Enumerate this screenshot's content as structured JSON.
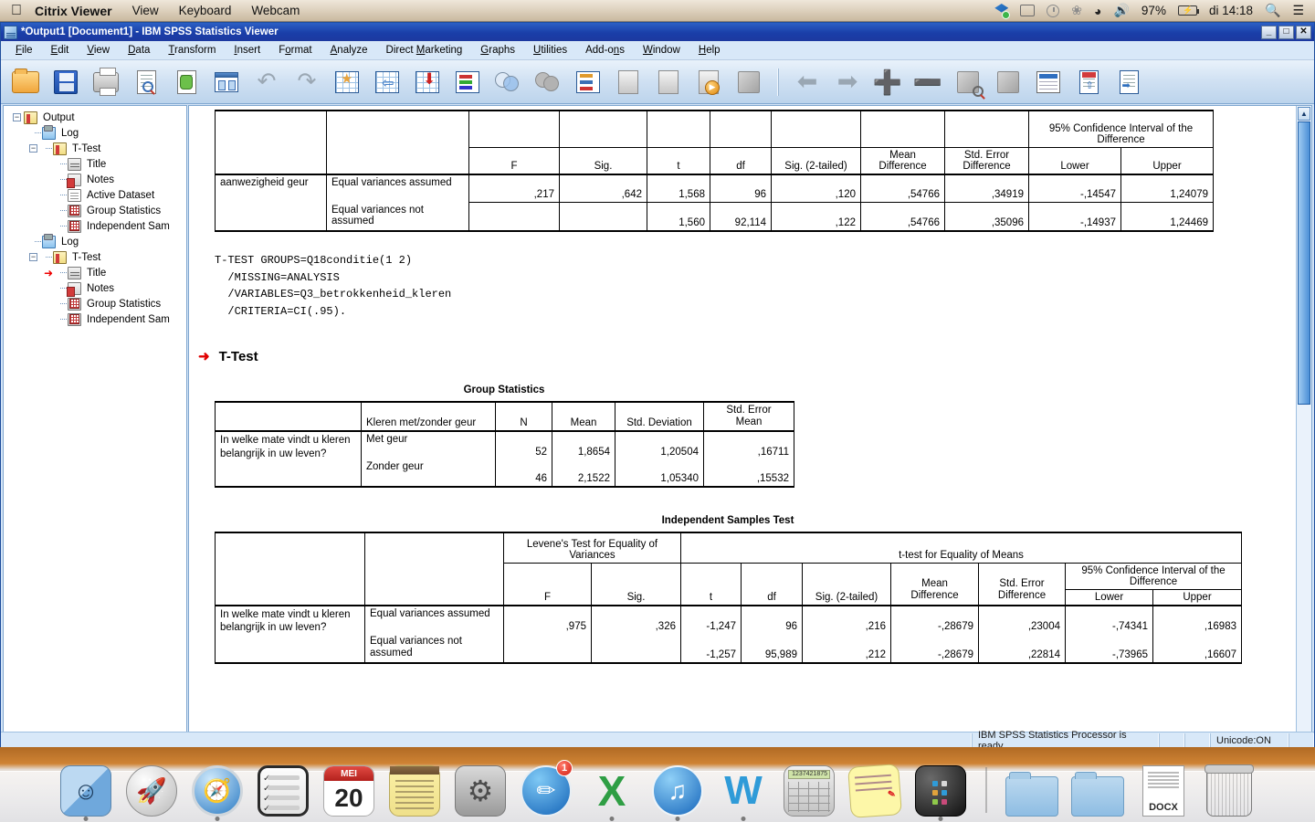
{
  "macbar": {
    "apple": "",
    "app_name": "Citrix Viewer",
    "menus": [
      "View",
      "Keyboard",
      "Webcam"
    ],
    "battery_pct": "97%",
    "clock": "di 14:18",
    "icons": [
      "dropbox-icon",
      "airplay-icon",
      "timemachine-icon",
      "bluetooth-icon",
      "wifi-icon",
      "volume-icon",
      "battery-icon",
      "spotlight-icon",
      "notification-center-icon"
    ]
  },
  "window": {
    "title": "*Output1 [Document1] - IBM SPSS Statistics Viewer",
    "minimize": "_",
    "maximize": "□",
    "close": "✕"
  },
  "menubar": {
    "items": [
      "File",
      "Edit",
      "View",
      "Data",
      "Transform",
      "Insert",
      "Format",
      "Analyze",
      "Direct Marketing",
      "Graphs",
      "Utilities",
      "Add-ons",
      "Window",
      "Help"
    ]
  },
  "toolbar": {
    "buttons": [
      "open-file-icon",
      "save-icon",
      "print-icon",
      "print-preview-icon",
      "recall-dialog-icon",
      "goto-data-icon",
      "undo-icon",
      "redo-icon",
      "goto-case-icon",
      "variables-icon",
      "insert-output-icon",
      "insert-syntax-icon",
      "venn-overlap-icon",
      "venn-solid-icon",
      "export-icon",
      "promote-icon",
      "demote-icon",
      "run-script-icon",
      "insert-image-icon",
      "back-icon",
      "forward-icon",
      "expand-icon",
      "collapse-icon",
      "preview-icon",
      "box-icon",
      "insert-title-icon",
      "insert-text-icon",
      "export-document-icon"
    ]
  },
  "tree": {
    "root": "Output",
    "items": [
      {
        "label": "Output",
        "icon": "output-icon",
        "level": 0,
        "toggle": "-"
      },
      {
        "label": "Log",
        "icon": "log-icon",
        "level": 1
      },
      {
        "label": "T-Test",
        "icon": "output-icon",
        "level": 1,
        "toggle": "-"
      },
      {
        "label": "Title",
        "icon": "title-icon",
        "level": 2
      },
      {
        "label": "Notes",
        "icon": "notes-icon",
        "level": 2
      },
      {
        "label": "Active Dataset",
        "icon": "dataset-icon",
        "level": 2
      },
      {
        "label": "Group Statistics",
        "icon": "table-icon",
        "level": 2
      },
      {
        "label": "Independent Sam",
        "icon": "table-icon",
        "level": 2
      },
      {
        "label": "Log",
        "icon": "log-icon",
        "level": 1
      },
      {
        "label": "T-Test",
        "icon": "output-icon",
        "level": 1,
        "toggle": "-"
      },
      {
        "label": "Title",
        "icon": "title-icon",
        "level": 2,
        "pointer": true
      },
      {
        "label": "Notes",
        "icon": "notes-icon",
        "level": 2
      },
      {
        "label": "Group Statistics",
        "icon": "table-icon",
        "level": 2
      },
      {
        "label": "Independent Sam",
        "icon": "table-icon",
        "level": 2
      }
    ]
  },
  "output": {
    "top_table": {
      "headers": {
        "f": "F",
        "sig": "Sig.",
        "t": "t",
        "df": "df",
        "sig2": "Sig. (2-tailed)",
        "mean_diff": "Mean Difference",
        "se_diff": "Std. Error Difference",
        "ci_title": "95% Confidence Interval of the Difference",
        "lower": "Lower",
        "upper": "Upper"
      },
      "row_label": "aanwezigheid geur",
      "rows": [
        {
          "assumption": "Equal variances assumed",
          "f": ",217",
          "sig": ",642",
          "t": "1,568",
          "df": "96",
          "sig2": ",120",
          "mean_diff": ",54766",
          "se_diff": ",34919",
          "lower": "-,14547",
          "upper": "1,24079"
        },
        {
          "assumption": "Equal variances not assumed",
          "f": "",
          "sig": "",
          "t": "1,560",
          "df": "92,114",
          "sig2": ",122",
          "mean_diff": ",54766",
          "se_diff": ",35096",
          "lower": "-,14937",
          "upper": "1,24469"
        }
      ]
    },
    "syntax": "T-TEST GROUPS=Q18conditie(1 2)\n  /MISSING=ANALYSIS\n  /VARIABLES=Q3_betrokkenheid_kleren\n  /CRITERIA=CI(.95).",
    "heading": "T-Test",
    "group_statistics": {
      "title": "Group Statistics",
      "headers": [
        "",
        "Kleren met/zonder geur",
        "N",
        "Mean",
        "Std. Deviation",
        "Std. Error Mean"
      ],
      "row_label": "In welke mate vindt u kleren belangrijk in uw leven?",
      "rows": [
        {
          "group": "Met geur",
          "n": "52",
          "mean": "1,8654",
          "sd": "1,20504",
          "sem": ",16711"
        },
        {
          "group": "Zonder geur",
          "n": "46",
          "mean": "2,1522",
          "sd": "1,05340",
          "sem": ",15532"
        }
      ]
    },
    "independent_samples": {
      "title": "Independent Samples Test",
      "levene_title": "Levene's Test for Equality of Variances",
      "ttest_title": "t-test for Equality of Means",
      "ci_title": "95% Confidence Interval of the Difference",
      "headers": {
        "f": "F",
        "sig": "Sig.",
        "t": "t",
        "df": "df",
        "sig2": "Sig. (2-tailed)",
        "mean_diff": "Mean Difference",
        "se_diff": "Std. Error Difference",
        "lower": "Lower",
        "upper": "Upper"
      },
      "row_label": "In welke mate vindt u kleren belangrijk in uw leven?",
      "rows": [
        {
          "assumption": "Equal variances assumed",
          "f": ",975",
          "sig": ",326",
          "t": "-1,247",
          "df": "96",
          "sig2": ",216",
          "mean_diff": "-,28679",
          "se_diff": ",23004",
          "lower": "-,74341",
          "upper": ",16983"
        },
        {
          "assumption": "Equal variances not assumed",
          "f": "",
          "sig": "",
          "t": "-1,257",
          "df": "95,989",
          "sig2": ",212",
          "mean_diff": "-,28679",
          "se_diff": ",22814",
          "lower": "-,73965",
          "upper": ",16607"
        }
      ]
    }
  },
  "statusbar": {
    "processor": "IBM SPSS Statistics Processor is ready",
    "unicode": "Unicode:ON"
  },
  "dock": {
    "items": [
      {
        "name": "finder",
        "label": "Finder",
        "running": true
      },
      {
        "name": "launchpad",
        "label": "Launchpad"
      },
      {
        "name": "safari",
        "label": "Safari",
        "running": true
      },
      {
        "name": "reminders",
        "label": "Reminders"
      },
      {
        "name": "calendar",
        "label": "Calendar",
        "month": "MEI",
        "day": "20"
      },
      {
        "name": "notes",
        "label": "Notes"
      },
      {
        "name": "system-preferences",
        "label": "System Preferences"
      },
      {
        "name": "app-store",
        "label": "App Store",
        "badge": "1"
      },
      {
        "name": "excel",
        "label": "Microsoft Excel",
        "glyph": "X",
        "running": true
      },
      {
        "name": "itunes",
        "label": "iTunes",
        "running": true
      },
      {
        "name": "word",
        "label": "Microsoft Word",
        "glyph": "W",
        "running": true
      },
      {
        "name": "calculator",
        "label": "Calculator",
        "display": "1237421875"
      },
      {
        "name": "stickies",
        "label": "Stickies"
      },
      {
        "name": "dark-app",
        "label": "Citrix Viewer",
        "running": true
      },
      {
        "name": "folder-1",
        "label": "Folder"
      },
      {
        "name": "folder-2",
        "label": "Folder"
      },
      {
        "name": "docx-file",
        "label": "DOCX",
        "glyph": "DOCX"
      },
      {
        "name": "trash",
        "label": "Trash"
      }
    ]
  }
}
